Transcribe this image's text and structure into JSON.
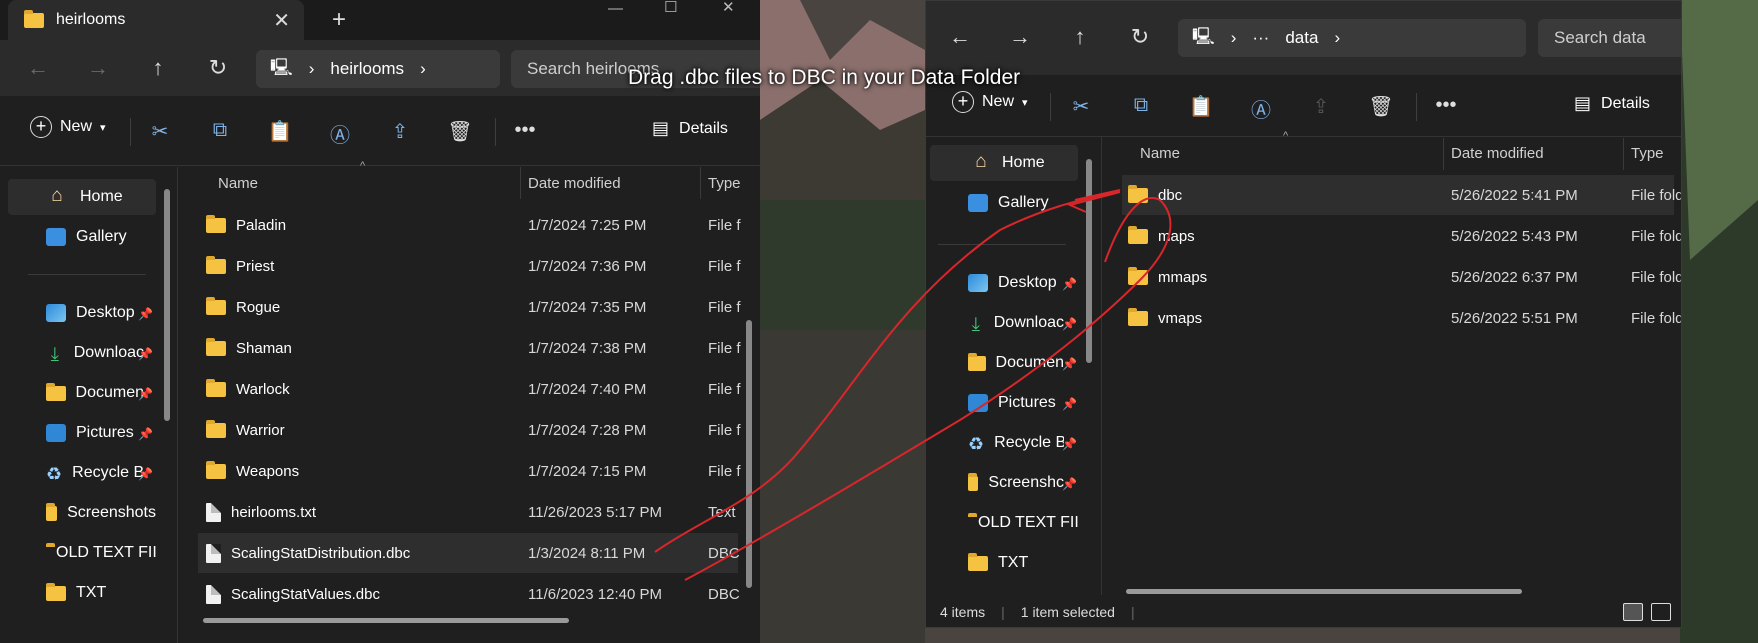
{
  "overlay_text": "Drag .dbc files to DBC in your Data Folder",
  "left": {
    "tab_title": "heirlooms",
    "address_segment": "heirlooms",
    "search_placeholder": "Search heirlooms",
    "toolbar": {
      "new_label": "New",
      "details_label": "Details"
    },
    "columns": {
      "name": "Name",
      "date": "Date modified",
      "type": "Type"
    },
    "sidebar": [
      {
        "label": "Home",
        "icon": "home-icon"
      },
      {
        "label": "Gallery",
        "icon": "gallery-icon"
      },
      {
        "label": "Desktop",
        "icon": "desktop-icon",
        "pinned": true
      },
      {
        "label": "Downloac",
        "icon": "download-icon",
        "pinned": true
      },
      {
        "label": "Documen",
        "icon": "folder-icon",
        "pinned": true
      },
      {
        "label": "Pictures",
        "icon": "pictures-icon",
        "pinned": true
      },
      {
        "label": "Recycle B",
        "icon": "recycle-bin-icon",
        "pinned": true
      },
      {
        "label": "Screenshots",
        "icon": "folder-icon"
      },
      {
        "label": "OLD TEXT FII",
        "icon": "folder-icon"
      },
      {
        "label": "TXT",
        "icon": "folder-icon"
      }
    ],
    "files": [
      {
        "name": "Paladin",
        "date": "1/7/2024 7:25 PM",
        "type": "File f",
        "kind": "folder"
      },
      {
        "name": "Priest",
        "date": "1/7/2024 7:36 PM",
        "type": "File f",
        "kind": "folder"
      },
      {
        "name": "Rogue",
        "date": "1/7/2024 7:35 PM",
        "type": "File f",
        "kind": "folder"
      },
      {
        "name": "Shaman",
        "date": "1/7/2024 7:38 PM",
        "type": "File f",
        "kind": "folder"
      },
      {
        "name": "Warlock",
        "date": "1/7/2024 7:40 PM",
        "type": "File f",
        "kind": "folder"
      },
      {
        "name": "Warrior",
        "date": "1/7/2024 7:28 PM",
        "type": "File f",
        "kind": "folder"
      },
      {
        "name": "Weapons",
        "date": "1/7/2024 7:15 PM",
        "type": "File f",
        "kind": "folder"
      },
      {
        "name": "heirlooms.txt",
        "date": "11/26/2023 5:17 PM",
        "type": "Text",
        "kind": "text"
      },
      {
        "name": "ScalingStatDistribution.dbc",
        "date": "1/3/2024 8:11 PM",
        "type": "DBC",
        "kind": "file",
        "selected": true
      },
      {
        "name": "ScalingStatValues.dbc",
        "date": "11/6/2023 12:40 PM",
        "type": "DBC",
        "kind": "file"
      }
    ]
  },
  "right": {
    "address_segment": "data",
    "ellipsis": "···",
    "search_placeholder": "Search data",
    "toolbar": {
      "new_label": "New",
      "details_label": "Details"
    },
    "columns": {
      "name": "Name",
      "date": "Date modified",
      "type": "Type"
    },
    "sidebar": [
      {
        "label": "Home",
        "icon": "home-icon"
      },
      {
        "label": "Gallery",
        "icon": "gallery-icon"
      },
      {
        "label": "Desktop",
        "icon": "desktop-icon",
        "pinned": true
      },
      {
        "label": "Downloac",
        "icon": "download-icon",
        "pinned": true
      },
      {
        "label": "Documen",
        "icon": "folder-icon",
        "pinned": true
      },
      {
        "label": "Pictures",
        "icon": "pictures-icon",
        "pinned": true
      },
      {
        "label": "Recycle B",
        "icon": "recycle-bin-icon",
        "pinned": true
      },
      {
        "label": "Screenshc",
        "icon": "folder-icon",
        "pinned": true
      },
      {
        "label": "OLD TEXT FII",
        "icon": "folder-icon"
      },
      {
        "label": "TXT",
        "icon": "folder-icon"
      }
    ],
    "files": [
      {
        "name": "dbc",
        "date": "5/26/2022 5:41 PM",
        "type": "File fold",
        "kind": "folder",
        "selected": true
      },
      {
        "name": "maps",
        "date": "5/26/2022 5:43 PM",
        "type": "File fold",
        "kind": "folder"
      },
      {
        "name": "mmaps",
        "date": "5/26/2022 6:37 PM",
        "type": "File fold",
        "kind": "folder"
      },
      {
        "name": "vmaps",
        "date": "5/26/2022 5:51 PM",
        "type": "File fold",
        "kind": "folder"
      }
    ],
    "status": {
      "count": "4 items",
      "selected": "1 item selected"
    }
  }
}
